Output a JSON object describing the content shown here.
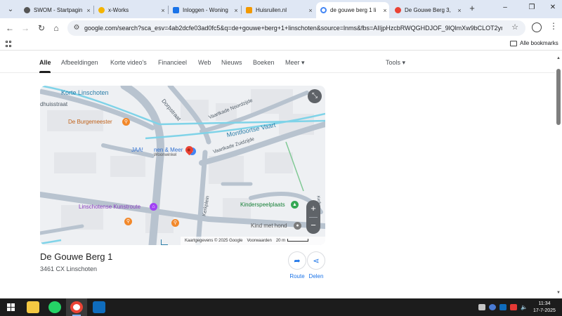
{
  "browser": {
    "tabs": [
      {
        "title": "SWOM - Startpagin",
        "favicon_color": "#555555",
        "active": false
      },
      {
        "title": "x-Works",
        "favicon_color": "#f4b400",
        "active": false
      },
      {
        "title": "Inloggen - Woning",
        "favicon_color": "#1a73e8",
        "active": false
      },
      {
        "title": "Huisruilen.nl",
        "favicon_color": "#f29900",
        "active": false
      },
      {
        "title": "de gouwe berg 1 li",
        "favicon_color": "#4285f4",
        "active": true
      },
      {
        "title": "De Gouwe Berg 3,",
        "favicon_color": "#ea4335",
        "active": false
      }
    ],
    "close_glyph": "×",
    "new_tab_glyph": "+",
    "url": "google.com/search?sca_esv=4ab2dcfe03ad0fc5&q=de+gouwe+berg+1+linschoten&source=lnms&fbs=AIIjpHzcbRWQGHDJOF_9lQlmXw9bCLOT2ymD…",
    "all_bookmarks": "Alle bookmarks"
  },
  "search_nav": {
    "tabs": [
      "Alle",
      "Afbeeldingen",
      "Korte video's",
      "Financieel",
      "Web",
      "Nieuws",
      "Boeken",
      "Meer"
    ],
    "active_tab": "Alle",
    "tools": "Tools"
  },
  "map": {
    "labels": {
      "korte_linschoten": "Korte Linschoten",
      "dorpstraat": "Dorpstraat",
      "vaartkade_noordzijde": "Vaartkade Noordzijde",
      "montfoortse_vaart": "Montfoortse Vaart",
      "vaartkade_zuidzijde": "Vaartkade Zuidzijde",
      "straat_left": "dhuisstraat",
      "burgemeester": "De Burgemeester",
      "jaa": "JAA!",
      "wonen_meer": "nen & Meer",
      "woonwinkel": "Woonwinkel",
      "kunstroute": "Linschotense Kunstroute",
      "kerkplein": "Kerkplein",
      "kinderspeelplaats": "Kinderspeelplaats",
      "kind_met_hond": "Kind met hond",
      "top_street": "Kerk"
    },
    "attribution": "Kaartgegevens © 2025 Google",
    "terms": "Voorwaarden",
    "scale": "20 m",
    "zoom_in": "+",
    "zoom_out": "−"
  },
  "place": {
    "title": "De Gouwe Berg 1",
    "address": "3461 CX Linschoten",
    "route_label": "Route",
    "share_label": "Delen"
  },
  "taskbar": {
    "time": "11:34",
    "date": "17-7-2025"
  }
}
